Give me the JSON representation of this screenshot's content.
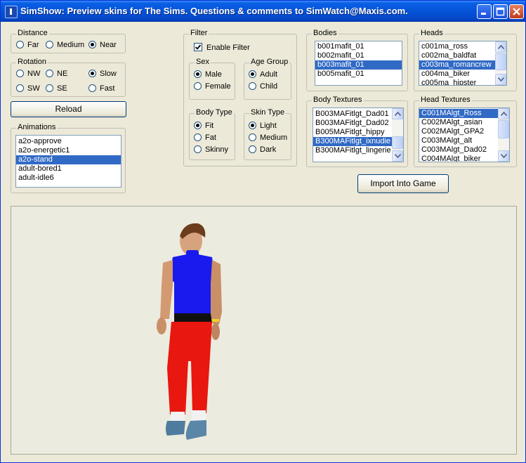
{
  "window": {
    "title": "SimShow: Preview skins for The Sims.  Questions & comments to SimWatch@Maxis.com."
  },
  "distance": {
    "label": "Distance",
    "options": [
      "Far",
      "Medium",
      "Near"
    ],
    "selected": "Near"
  },
  "rotation": {
    "label": "Rotation",
    "options": [
      "NW",
      "NE",
      "Slow",
      "SW",
      "SE",
      "Fast"
    ],
    "selected": "Slow"
  },
  "reload_label": "Reload",
  "animations": {
    "label": "Animations",
    "items": [
      "a2o-approve",
      "a2o-energetic1",
      "a2o-stand",
      "adult-bored1",
      "adult-idle6"
    ],
    "selected": "a2o-stand"
  },
  "filter": {
    "label": "Filter",
    "enable_label": "Enable Filter",
    "enabled": true,
    "sex": {
      "label": "Sex",
      "options": [
        "Male",
        "Female"
      ],
      "selected": "Male"
    },
    "age_group": {
      "label": "Age Group",
      "options": [
        "Adult",
        "Child"
      ],
      "selected": "Adult"
    },
    "body_type": {
      "label": "Body Type",
      "options": [
        "Fit",
        "Fat",
        "Skinny"
      ],
      "selected": "Fit"
    },
    "skin_type": {
      "label": "Skin Type",
      "options": [
        "Light",
        "Medium",
        "Dark"
      ],
      "selected": "Light"
    }
  },
  "bodies": {
    "label": "Bodies",
    "items": [
      "b001mafit_01",
      "b002mafit_01",
      "b003mafit_01",
      "b005mafit_01"
    ],
    "selected": "b003mafit_01"
  },
  "heads": {
    "label": "Heads",
    "items": [
      "c001ma_ross",
      "c002ma_baldfat",
      "c003ma_romancrew",
      "c004ma_biker",
      "c005ma_hipster"
    ],
    "selected": "c003ma_romancrew"
  },
  "body_textures": {
    "label": "Body Textures",
    "items": [
      "B003MAFitlgt_Dad01",
      "B003MAFitlgt_Dad02",
      "B005MAFitlgt_hippy",
      "B300MAFitlgt_ixnudie",
      "B300MAFitlgt_lingerie"
    ],
    "selected": "B300MAFitlgt_ixnudie"
  },
  "head_textures": {
    "label": "Head Textures",
    "items": [
      "C001MAlgt_Ross",
      "C002MAlgt_asian",
      "C002MAlgt_GPA2",
      "C003MAlgt_alt",
      "C003MAlgt_Dad02",
      "C004MAlgt_biker"
    ],
    "selected": "C001MAlgt_Ross"
  },
  "import_label": "Import Into Game",
  "colors": {
    "selection": "#316ac5",
    "face": "#ece9d8",
    "shirt": "#1a1aee",
    "pants": "#e8170f"
  }
}
